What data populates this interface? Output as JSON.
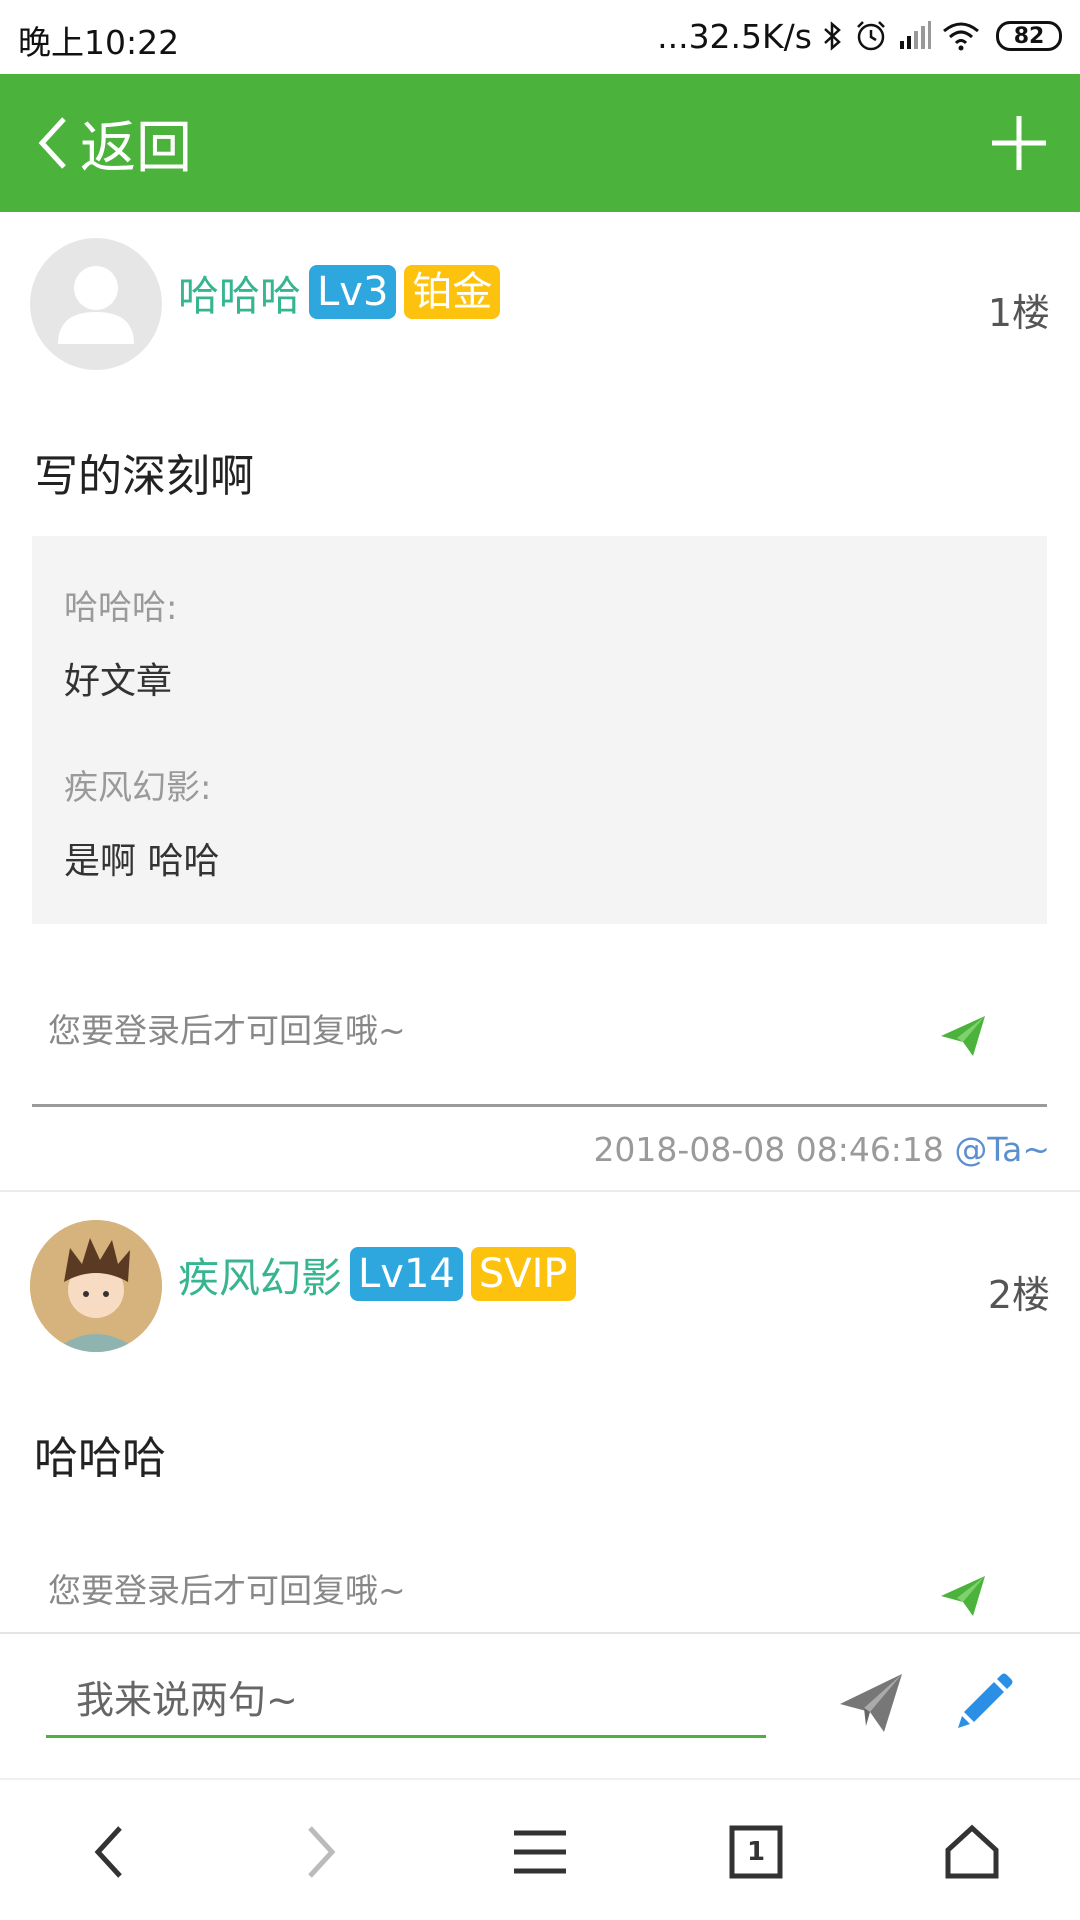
{
  "status_bar": {
    "time": "晚上10:22",
    "network_speed": "...32.5K/s",
    "battery": "82"
  },
  "header": {
    "back_label": "返回",
    "add_icon": "plus-icon",
    "color": "#4bb33b"
  },
  "posts": [
    {
      "username": "哈哈哈",
      "level": "Lv3",
      "rank": "铂金",
      "floor": "1楼",
      "content": "写的深刻啊",
      "replies": [
        {
          "name": "哈哈哈:",
          "text": "好文章"
        },
        {
          "name": "疾风幻影:",
          "text": "是啊 哈哈"
        }
      ],
      "reply_placeholder": "您要登录后才可回复哦~",
      "timestamp": "2018-08-08 08:46:18",
      "at_label": "@Ta~"
    },
    {
      "username": "疾风幻影",
      "level": "Lv14",
      "rank": "SVIP",
      "floor": "2楼",
      "content": "哈哈哈",
      "reply_placeholder": "您要登录后才可回复哦~"
    }
  ],
  "input_bar": {
    "placeholder": "我来说两句~"
  },
  "browser_nav": {
    "tab_count": "1"
  },
  "colors": {
    "accent_green": "#4bb33b",
    "username": "#37b590",
    "level_badge": "#2ea7df",
    "rank_badge": "#fcc20e",
    "link_blue": "#5b8fd0",
    "pen_blue": "#2b8fe6"
  }
}
